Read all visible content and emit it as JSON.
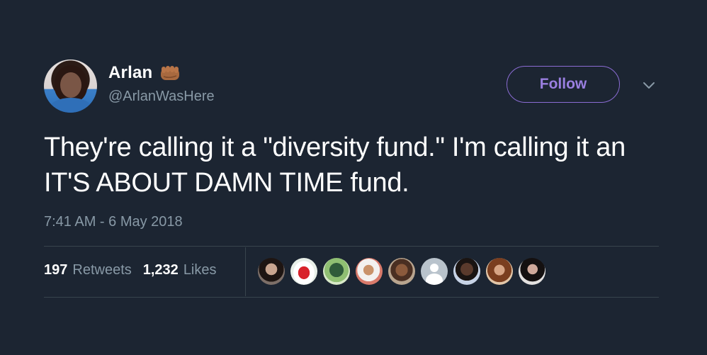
{
  "user": {
    "display_name": "Arlan",
    "handle": "@ArlanWasHere",
    "name_emoji": "fist-bump-icon"
  },
  "actions": {
    "follow_label": "Follow",
    "more_menu_icon": "chevron-down-icon"
  },
  "tweet": {
    "text": "They're calling it a \"diversity fund.\" I'm calling it an IT'S ABOUT DAMN TIME fund.",
    "timestamp": "7:41 AM - 6 May 2018"
  },
  "stats": {
    "retweets_count": "197",
    "retweets_label": "Retweets",
    "likes_count": "1,232",
    "likes_label": "Likes"
  },
  "liked_by_avatars": [
    "user-avatar",
    "user-avatar",
    "user-avatar",
    "user-avatar",
    "user-avatar",
    "default-avatar",
    "user-avatar",
    "user-avatar",
    "user-avatar"
  ],
  "colors": {
    "background": "#1c2532",
    "follow_accent": "#9a7fe0",
    "secondary_text": "#8899a6",
    "divider": "#38444d"
  }
}
